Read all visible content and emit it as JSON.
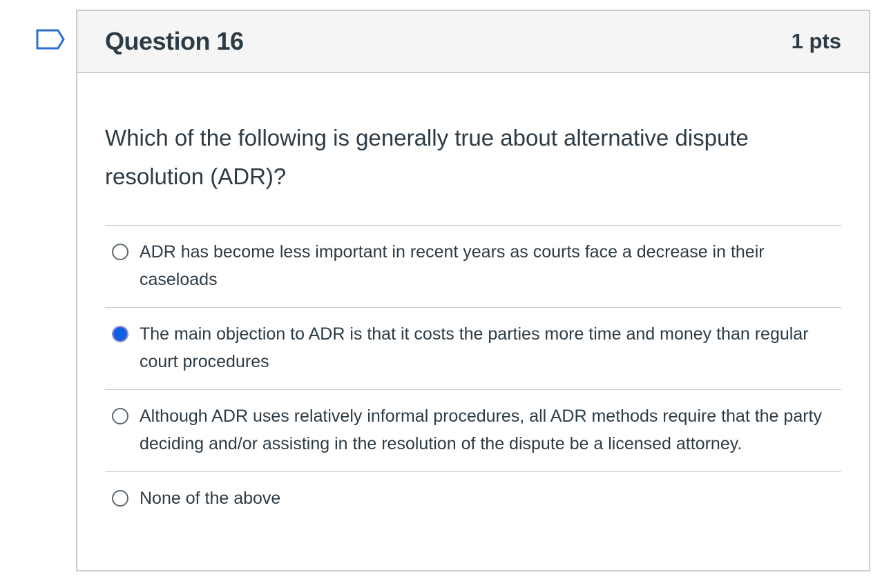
{
  "question": {
    "title": "Question 16",
    "points": "1 pts",
    "text": "Which of the following is generally true about alternative dispute resolution (ADR)?",
    "answers": [
      {
        "label": "ADR has become less important in recent years as courts face a decrease in their caseloads",
        "selected": false
      },
      {
        "label": "The main objection to ADR is that it costs the parties more time and money than regular court procedures",
        "selected": true
      },
      {
        "label": "Although ADR uses relatively informal procedures, all ADR methods require that the party deciding and/or assisting in the resolution of the dispute be a licensed attorney.",
        "selected": false
      },
      {
        "label": "None of the above",
        "selected": false
      }
    ]
  },
  "icons": {
    "flag": "flag-question-icon"
  },
  "colors": {
    "selected_radio": "#1060e6",
    "border": "#c7cdd1",
    "header_bg": "#f5f5f5",
    "text": "#2d3b45"
  }
}
